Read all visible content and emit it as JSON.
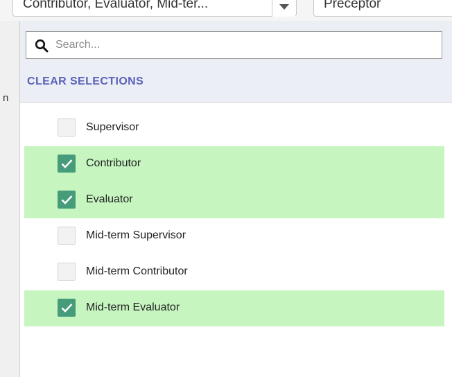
{
  "background": {
    "role_select_text": "Contributor, Evaluator, Mid-ter...",
    "second_select_text": "Preceptor",
    "left_edge_char": "n"
  },
  "dropdown": {
    "search_placeholder": "Search...",
    "clear_label": "CLEAR SELECTIONS",
    "options": [
      {
        "label": "Supervisor",
        "checked": false
      },
      {
        "label": "Contributor",
        "checked": true
      },
      {
        "label": "Evaluator",
        "checked": true
      },
      {
        "label": "Mid-term Supervisor",
        "checked": false
      },
      {
        "label": "Mid-term Contributor",
        "checked": false
      },
      {
        "label": "Mid-term Evaluator",
        "checked": true
      }
    ]
  },
  "colors": {
    "checked_row": "#c6f5c0",
    "checkbox_checked": "#459b7a",
    "header_bg": "#eceef6",
    "link": "#5a62b8"
  },
  "icons": {
    "search": "search-icon",
    "check": "check-icon",
    "dropdown_arrow": "chevron-down-icon"
  }
}
